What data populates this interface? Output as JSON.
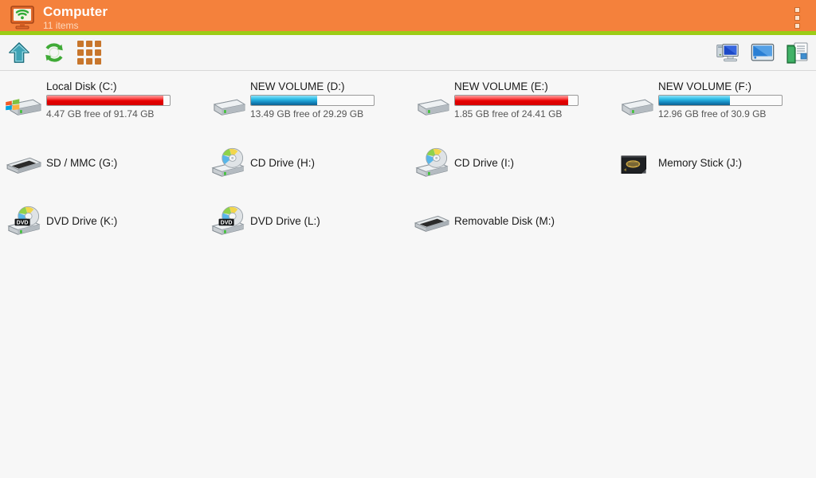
{
  "header": {
    "title": "Computer",
    "subtitle": "11 items",
    "icon": "computer-monitor-icon",
    "overflow_icon": "overflow-menu-icon",
    "bg_color": "#f4813c",
    "accent_color": "#9ccc16"
  },
  "toolbar": {
    "left_buttons": [
      {
        "name": "up-arrow-icon",
        "label": "Up"
      },
      {
        "name": "refresh-icon",
        "label": "Refresh"
      },
      {
        "name": "grid-view-icon",
        "label": "Grid view"
      }
    ],
    "right_buttons": [
      {
        "name": "my-computer-icon",
        "label": "My Computer"
      },
      {
        "name": "desktop-icon",
        "label": "Desktop"
      },
      {
        "name": "documents-folder-icon",
        "label": "Documents"
      }
    ]
  },
  "drives": [
    {
      "name": "Local Disk (C:)",
      "free_text": "4.47 GB free of 91.74 GB",
      "icon": "hard-disk-windows-icon",
      "has_bar": true,
      "bar_color": "red",
      "used_percent": 95
    },
    {
      "name": "NEW VOLUME (D:)",
      "free_text": "13.49 GB free of 29.29 GB",
      "icon": "hard-disk-icon",
      "has_bar": true,
      "bar_color": "blue",
      "used_percent": 54
    },
    {
      "name": "NEW VOLUME (E:)",
      "free_text": "1.85 GB free of 24.41 GB",
      "icon": "hard-disk-icon",
      "has_bar": true,
      "bar_color": "red",
      "used_percent": 92
    },
    {
      "name": "NEW VOLUME (F:)",
      "free_text": "12.96 GB free of 30.9 GB",
      "icon": "hard-disk-icon",
      "has_bar": true,
      "bar_color": "blue",
      "used_percent": 58
    },
    {
      "name": "SD / MMC (G:)",
      "free_text": "",
      "icon": "card-reader-icon",
      "has_bar": false
    },
    {
      "name": "CD Drive (H:)",
      "free_text": "",
      "icon": "cd-drive-icon",
      "has_bar": false
    },
    {
      "name": "CD Drive (I:)",
      "free_text": "",
      "icon": "cd-drive-icon",
      "has_bar": false
    },
    {
      "name": "Memory Stick (J:)",
      "free_text": "",
      "icon": "memory-stick-icon",
      "has_bar": false
    },
    {
      "name": "DVD Drive (K:)",
      "free_text": "",
      "icon": "dvd-drive-icon",
      "has_bar": false,
      "badge": "DVD"
    },
    {
      "name": "DVD Drive (L:)",
      "free_text": "",
      "icon": "dvd-drive-icon",
      "has_bar": false,
      "badge": "DVD"
    },
    {
      "name": "Removable Disk (M:)",
      "free_text": "",
      "icon": "card-reader-icon",
      "has_bar": false
    }
  ]
}
